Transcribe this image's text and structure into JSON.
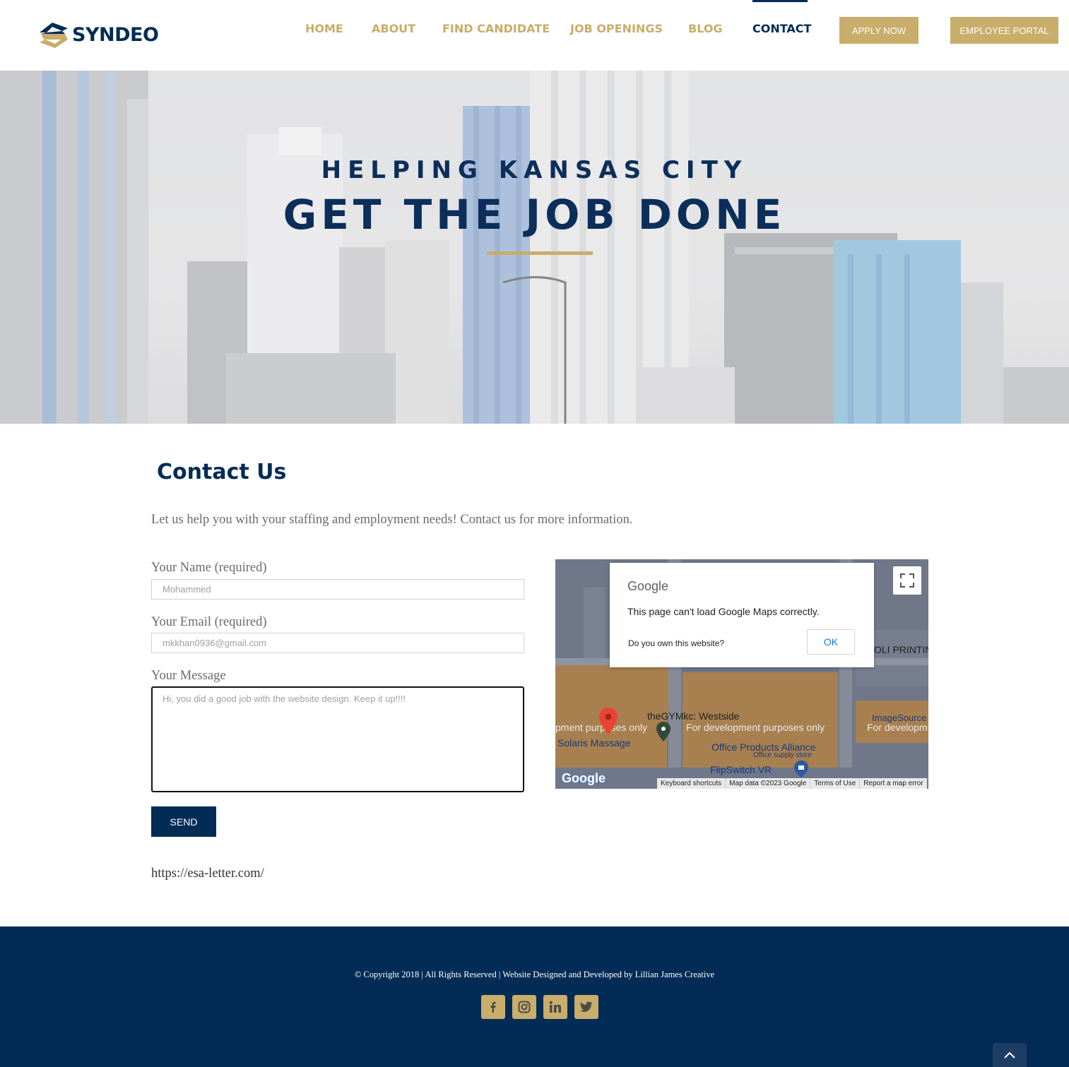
{
  "brand": {
    "name": "SYNDEO",
    "navy": "#022b55",
    "gold": "#c9ad6a"
  },
  "nav": {
    "items": [
      {
        "label": "HOME"
      },
      {
        "label": "ABOUT"
      },
      {
        "label": "FIND CANDIDATE"
      },
      {
        "label": "JOB OPENINGS"
      },
      {
        "label": "BLOG"
      },
      {
        "label": "CONTACT",
        "active": true
      }
    ],
    "apply_label": "APPLY NOW",
    "portal_label": "EMPLOYEE PORTAL"
  },
  "hero": {
    "subtitle": "HELPING KANSAS CITY",
    "title": "GET THE JOB DONE"
  },
  "contact": {
    "title": "Contact Us",
    "intro": "Let us help you with your staffing and employment needs! Contact us for more information.",
    "name_label": "Your Name (required)",
    "name_value": "Mohammed",
    "email_label": "Your Email (required)",
    "email_value": "mkkhan0936@gmail.com",
    "message_label": "Your Message",
    "message_value": "Hi, you did a good job with the website design. Keep it up!!!!",
    "send_label": "SEND",
    "link_text": "https://esa-letter.com/"
  },
  "map": {
    "dialog_logo": "Google",
    "dialog_message": "This page can't load Google Maps correctly.",
    "dialog_question": "Do you own this website?",
    "dialog_ok": "OK",
    "labels": {
      "printing": "OLI PRINTIN",
      "gym": "theGYMkc: Westside",
      "dev1": "pment purposes only",
      "dev2": "For development purposes only",
      "dev3": "For developm",
      "imagesource": "ImageSource",
      "solaris": "Solaris Massage",
      "office": "Office Products Alliance",
      "office_sub": "Office supply store",
      "flipswitch": "FlipSwitch VR"
    },
    "google_mark": "Google",
    "footer": {
      "shortcuts": "Keyboard shortcuts",
      "data": "Map data ©2023 Google",
      "terms": "Terms of Use",
      "report": "Report a map error"
    }
  },
  "footer": {
    "copyright": "© Copyright 2018 | All Rights Reserved | Website Designed and Developed by Lillian James Creative",
    "social": [
      "facebook-icon",
      "instagram-icon",
      "linkedin-icon",
      "twitter-icon"
    ]
  }
}
